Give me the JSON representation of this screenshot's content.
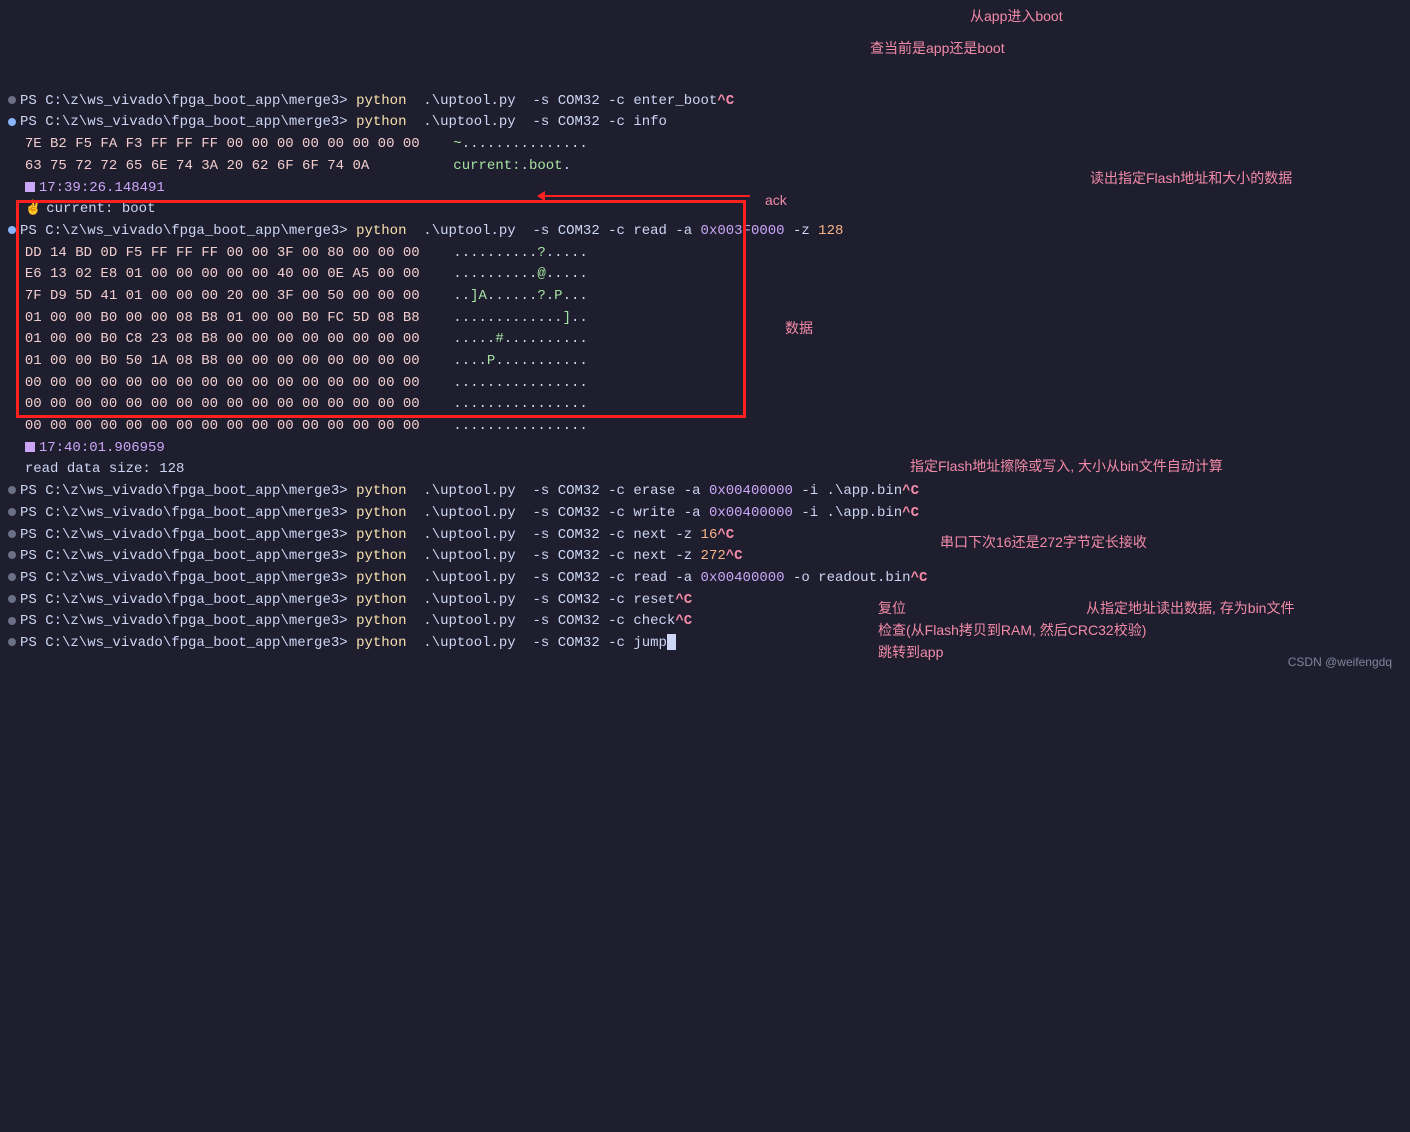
{
  "prompt": "PS C:\\z\\ws_vivado\\fpga_boot_app\\merge3>",
  "cmd_python": "python",
  "script": ".\\uptool.py",
  "flag_s": "-s",
  "port": "COM32",
  "flag_c": "-c",
  "flag_a": "-a",
  "flag_z": "-z",
  "flag_i": "-i",
  "flag_o": "-o",
  "ctrl_c": "^C",
  "commands": {
    "enter_boot": "enter_boot",
    "info": "info",
    "read": "read",
    "erase": "erase",
    "write": "write",
    "next": "next",
    "reset": "reset",
    "check": "check",
    "jump": "jump"
  },
  "addrs": {
    "a1": "0x003F0000",
    "a2": "0x00400000",
    "input_bin": ".\\app.bin",
    "output_bin": "readout.bin"
  },
  "nums": {
    "z128": "128",
    "z16": "16",
    "z272": "272"
  },
  "info_lines": {
    "hex1": "7E B2 F5 FA F3 FF FF FF 00 00 00 00 00 00 00 00",
    "asc1": "~...............",
    "hex2": "63 75 72 72 65 6E 74 3A 20 62 6F 6F 74 0A",
    "asc2": "current:.boot."
  },
  "ts1": "17:39:26.148491",
  "vrow": "current: boot",
  "ack_hex": "DD 14 BD 0D F5 FF FF FF 00 00 3F 00 80 00 00 00",
  "ack_asc": "..........?.....",
  "data_rows": [
    {
      "hex": "E6 13 02 E8 01 00 00 00 00 00 40 00 0E A5 00 00",
      "asc": "..........@....."
    },
    {
      "hex": "7F D9 5D 41 01 00 00 00 20 00 3F 00 50 00 00 00",
      "asc": "..]A......?.P..."
    },
    {
      "hex": "01 00 00 B0 00 00 08 B8 01 00 00 B0 FC 5D 08 B8",
      "asc": ".............].."
    },
    {
      "hex": "01 00 00 B0 C8 23 08 B8 00 00 00 00 00 00 00 00",
      "asc": ".....#.........."
    },
    {
      "hex": "01 00 00 B0 50 1A 08 B8 00 00 00 00 00 00 00 00",
      "asc": "....P..........."
    },
    {
      "hex": "00 00 00 00 00 00 00 00 00 00 00 00 00 00 00 00",
      "asc": "................"
    },
    {
      "hex": "00 00 00 00 00 00 00 00 00 00 00 00 00 00 00 00",
      "asc": "................"
    },
    {
      "hex": "00 00 00 00 00 00 00 00 00 00 00 00 00 00 00 00",
      "asc": "................"
    }
  ],
  "ts2": "17:40:01.906959",
  "read_size": "read data size: 128",
  "annotations": {
    "a_enter": "从app进入boot",
    "a_info": "查当前是app还是boot",
    "a_read": "读出指定Flash地址和大小的数据",
    "a_ack": "ack",
    "a_data": "数据",
    "a_erase": "指定Flash地址擦除或写入, 大小从bin文件自动计算",
    "a_next": "串口下次16还是272字节定长接收",
    "a_reset": "复位",
    "a_readout": "从指定地址读出数据, 存为bin文件",
    "a_check": "检查(从Flash拷贝到RAM, 然后CRC32校验)",
    "a_jump": "跳转到app"
  },
  "watermark": "CSDN @weifengdq"
}
